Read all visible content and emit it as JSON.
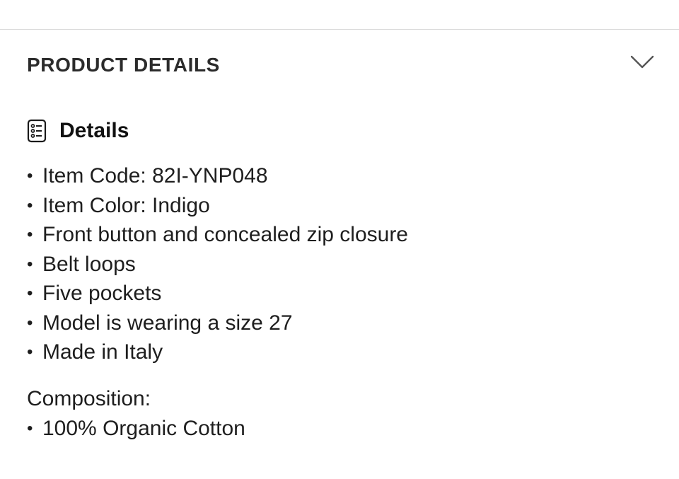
{
  "section": {
    "title": "PRODUCT DETAILS",
    "toggle_icon": "chevron-down-icon"
  },
  "details": {
    "icon": "list-details-icon",
    "heading": "Details",
    "bullet": "•",
    "items": [
      "Item Code: 82I-YNP048",
      "Item Color: Indigo",
      "Front button and concealed zip closure",
      "Belt loops",
      "Five pockets",
      "Model is wearing a size 27",
      "Made in Italy"
    ]
  },
  "composition": {
    "label": "Composition:",
    "items": [
      "100% Organic Cotton"
    ]
  }
}
